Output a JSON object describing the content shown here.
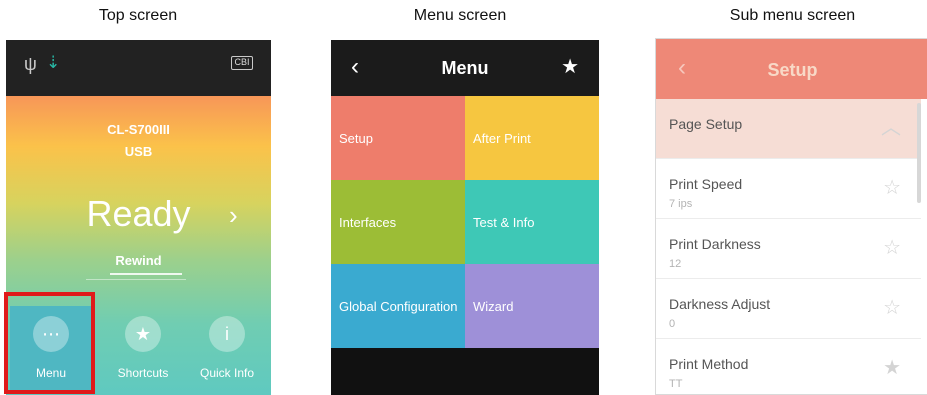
{
  "captions": {
    "top": "Top screen",
    "menu": "Menu screen",
    "submenu": "Sub menu screen"
  },
  "top_screen": {
    "status_icons": [
      "usb-icon",
      "transfer-arrow-icon",
      "battery-icon"
    ],
    "battery_text": "CBI",
    "model": "CL-S700III",
    "interface": "USB",
    "status": "Ready",
    "mode": "Rewind",
    "buttons": [
      {
        "label": "Menu",
        "icon": "menu-icon"
      },
      {
        "label": "Shortcuts",
        "icon": "star-icon"
      },
      {
        "label": "Quick Info",
        "icon": "info-icon"
      }
    ],
    "highlight_color": "#e01a1a"
  },
  "menu_screen": {
    "title": "Menu",
    "tiles": [
      {
        "label": "Setup",
        "color": "#ee7d6b"
      },
      {
        "label": "After Print",
        "color": "#f6c640"
      },
      {
        "label": "Interfaces",
        "color": "#9cbd36"
      },
      {
        "label": "Test & Info",
        "color": "#3ec8b6"
      },
      {
        "label": "Global Configuration",
        "color": "#3aaad0"
      },
      {
        "label": "Wizard",
        "color": "#9e90d8"
      }
    ]
  },
  "sub_menu_screen": {
    "title": "Setup",
    "items": [
      {
        "label": "Page Setup",
        "value": "",
        "icon": "chevron-up-icon"
      },
      {
        "label": "Print Speed",
        "value": "7 ips",
        "icon": "star-outline-icon"
      },
      {
        "label": "Print Darkness",
        "value": "12",
        "icon": "star-outline-icon"
      },
      {
        "label": "Darkness Adjust",
        "value": "0",
        "icon": "star-outline-icon"
      },
      {
        "label": "Print Method",
        "value": "TT",
        "icon": "star-filled-icon"
      }
    ]
  }
}
